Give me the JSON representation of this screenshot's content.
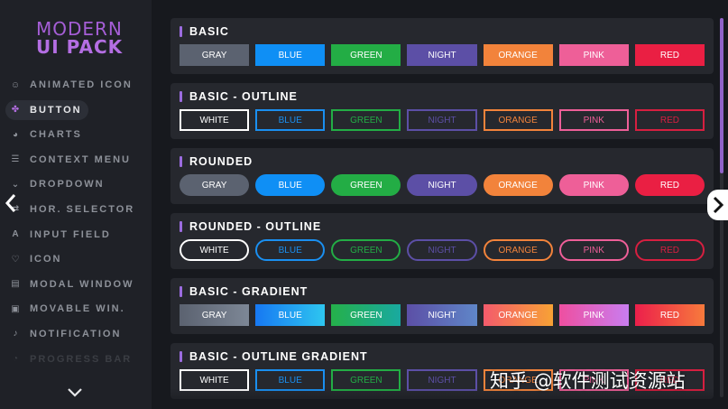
{
  "app": {
    "logo_line1": "MODERN",
    "logo_line2": "UI PACK"
  },
  "sidebar": {
    "items": [
      {
        "label": "ANIMATED ICON",
        "icon": "smiley-icon",
        "glyph": "☺"
      },
      {
        "label": "BUTTON",
        "icon": "gamepad-icon",
        "glyph": "✤"
      },
      {
        "label": "CHARTS",
        "icon": "pie-chart-icon",
        "glyph": "◕"
      },
      {
        "label": "CONTEXT MENU",
        "icon": "list-icon",
        "glyph": "☰"
      },
      {
        "label": "DROPDOWN",
        "icon": "dropdown-icon",
        "glyph": "⌄"
      },
      {
        "label": "HOR. SELECTOR",
        "icon": "selector-icon",
        "glyph": "⇄"
      },
      {
        "label": "INPUT FIELD",
        "icon": "input-icon",
        "glyph": "A"
      },
      {
        "label": "ICON",
        "icon": "heart-icon",
        "glyph": "♡"
      },
      {
        "label": "MODAL WINDOW",
        "icon": "modal-icon",
        "glyph": "▤"
      },
      {
        "label": "MOVABLE WIN.",
        "icon": "window-icon",
        "glyph": "▣"
      },
      {
        "label": "NOTIFICATION",
        "icon": "bell-icon",
        "glyph": "♪"
      },
      {
        "label": "PROGRESS BAR",
        "icon": "progress-icon",
        "glyph": "◔"
      }
    ],
    "active_index": 1
  },
  "sections": [
    {
      "title": "BASIC",
      "style": "basic",
      "buttons": [
        {
          "label": "GRAY",
          "bg": "#5b6270"
        },
        {
          "label": "BLUE",
          "bg": "#0f8ff5"
        },
        {
          "label": "GREEN",
          "bg": "#23ad45"
        },
        {
          "label": "NIGHT",
          "bg": "#5c4fa6"
        },
        {
          "label": "ORANGE",
          "bg": "#f2833b"
        },
        {
          "label": "PINK",
          "bg": "#ee5f98"
        },
        {
          "label": "RED",
          "bg": "#ea1f43"
        }
      ]
    },
    {
      "title": "BASIC - OUTLINE",
      "style": "outline",
      "buttons": [
        {
          "label": "WHITE",
          "color": "#ffffff"
        },
        {
          "label": "BLUE",
          "color": "#1a8ff0"
        },
        {
          "label": "GREEN",
          "color": "#23ad45"
        },
        {
          "label": "NIGHT",
          "color": "#5c4fa6"
        },
        {
          "label": "ORANGE",
          "color": "#f2833b"
        },
        {
          "label": "PINK",
          "color": "#ee5f98"
        },
        {
          "label": "RED",
          "color": "#d61f40"
        }
      ]
    },
    {
      "title": "ROUNDED",
      "style": "rounded",
      "buttons": [
        {
          "label": "GRAY",
          "bg": "#5b6270"
        },
        {
          "label": "BLUE",
          "bg": "#0f8ff5"
        },
        {
          "label": "GREEN",
          "bg": "#23ad45"
        },
        {
          "label": "NIGHT",
          "bg": "#5c4fa6"
        },
        {
          "label": "ORANGE",
          "bg": "#f2833b"
        },
        {
          "label": "PINK",
          "bg": "#ee5f98"
        },
        {
          "label": "RED",
          "bg": "#ea1f43"
        }
      ]
    },
    {
      "title": "ROUNDED - OUTLINE",
      "style": "outline-rounded",
      "buttons": [
        {
          "label": "WHITE",
          "color": "#ffffff"
        },
        {
          "label": "BLUE",
          "color": "#1a8ff0"
        },
        {
          "label": "GREEN",
          "color": "#23ad45"
        },
        {
          "label": "NIGHT",
          "color": "#5c4fa6"
        },
        {
          "label": "ORANGE",
          "color": "#f2833b"
        },
        {
          "label": "PINK",
          "color": "#ee5f98"
        },
        {
          "label": "RED",
          "color": "#d61f40"
        }
      ]
    },
    {
      "title": "BASIC - GRADIENT",
      "style": "gradient",
      "buttons": [
        {
          "label": "GRAY",
          "from": "#5b6270",
          "to": "#7d8796"
        },
        {
          "label": "BLUE",
          "from": "#1778f2",
          "to": "#2ec6f0"
        },
        {
          "label": "GREEN",
          "from": "#25b04a",
          "to": "#19a9a0"
        },
        {
          "label": "NIGHT",
          "from": "#5c4fa6",
          "to": "#5f86c8"
        },
        {
          "label": "ORANGE",
          "from": "#f45b6c",
          "to": "#f7a235"
        },
        {
          "label": "PINK",
          "from": "#ee4fa0",
          "to": "#c97df0"
        },
        {
          "label": "RED",
          "from": "#ec1f4b",
          "to": "#f77a3c"
        }
      ]
    },
    {
      "title": "BASIC - OUTLINE GRADIENT",
      "style": "outline",
      "buttons": [
        {
          "label": "WHITE",
          "color": "#ffffff"
        },
        {
          "label": "BLUE",
          "color": "#1a8ff0"
        },
        {
          "label": "GREEN",
          "color": "#23ad45"
        },
        {
          "label": "NIGHT",
          "color": "#5c4fa6"
        },
        {
          "label": "ORANGE",
          "color": "#f2833b"
        },
        {
          "label": "PINK",
          "color": "#ee5f98"
        },
        {
          "label": "RED",
          "color": "#d61f40"
        }
      ]
    }
  ],
  "watermark": "知乎 @软件测试资源站"
}
